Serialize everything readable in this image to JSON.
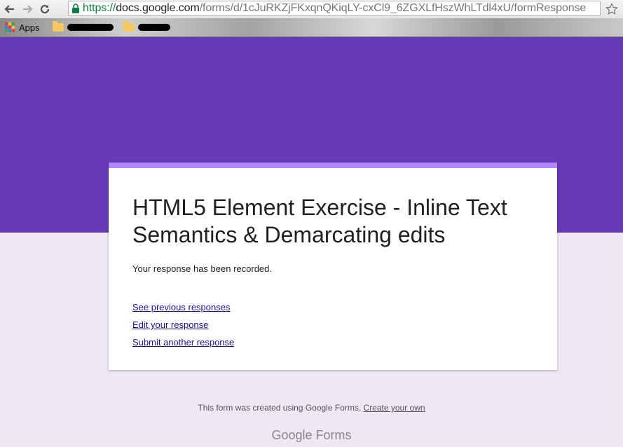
{
  "browser": {
    "url_scheme": "https://",
    "url_host": "docs.google.com",
    "url_path": "/forms/d/1cJuRKZjFKxqnQKiqLY-cxCl9_6ZGXLfHszWhLTdl4xU/formResponse",
    "bookmarks": {
      "apps_label": "Apps"
    }
  },
  "form": {
    "title": "HTML5 Element Exercise - Inline Text Semantics & Demarcating edits",
    "confirmation": "Your response has been recorded.",
    "links": {
      "previous": "See previous responses",
      "edit": "Edit your response",
      "another": "Submit another response"
    }
  },
  "footer": {
    "text": "This form was created using Google Forms.",
    "create_link": "Create your own",
    "brand_google": "Google",
    "brand_forms": "Forms"
  },
  "colors": {
    "accent": "#673ab7",
    "card_top": "#b388ff",
    "page_bg": "#ede7f6",
    "link": "#1a0dab"
  }
}
